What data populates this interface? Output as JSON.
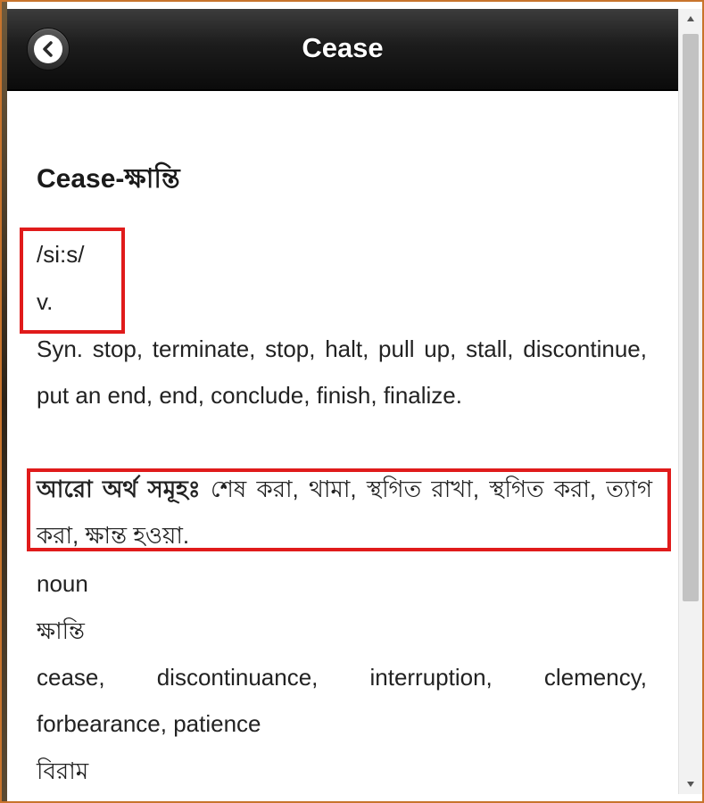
{
  "header": {
    "title": "Cease",
    "back_icon": "chevron-left-icon"
  },
  "entry": {
    "headword": "Cease-ক্ষান্তি",
    "pronunciation": "/si:s/",
    "part_of_speech": "v.",
    "synonyms": "Syn. stop, terminate, stop, halt, pull up, stall, discontinue, put an end, end, conclude, finish, finalize.",
    "more_meanings_label": "আরো অর্থ সমূহঃ",
    "more_meanings_text": "শেষ করা, থামা, স্থগিত রাখা, স্থগিত করা, ত্যাগ করা, ক্ষান্ত হওয়া.",
    "noun_label": "noun",
    "noun_bangla": "ক্ষান্তি",
    "noun_synonyms": "cease, discontinuance, interruption, clemency, forbearance, patience",
    "noun_bangla_2": "বিরাম"
  },
  "colors": {
    "header_bg": "#1c1c1c",
    "highlight": "#e01b1b",
    "frame": "#c8742c"
  }
}
